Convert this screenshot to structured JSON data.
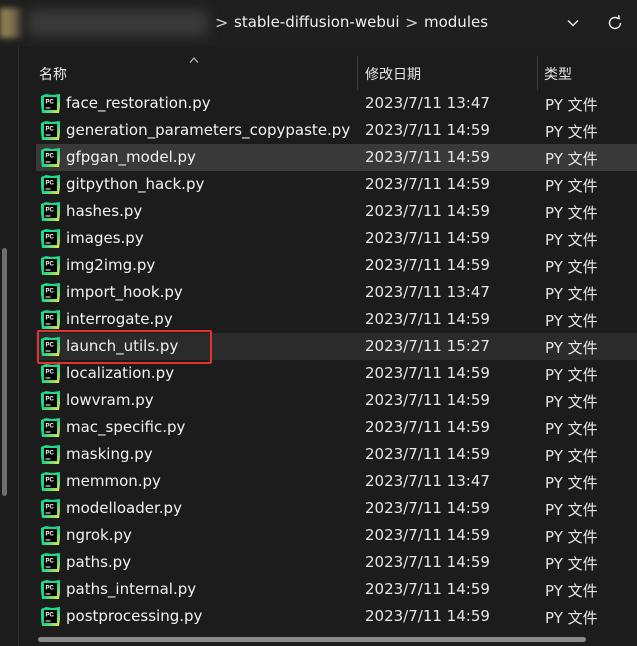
{
  "address_bar": {
    "crumbs": [
      "stable-diffusion-webui",
      "modules"
    ],
    "separator": ">",
    "dropdown_icon": "chevron-down-icon",
    "refresh_icon": "refresh-icon"
  },
  "columns": {
    "name": "名称",
    "modified": "修改日期",
    "type": "类型"
  },
  "files": [
    {
      "name": "face_restoration.py",
      "modified": "2023/7/11 13:47",
      "type": "PY 文件"
    },
    {
      "name": "generation_parameters_copypaste.py",
      "modified": "2023/7/11 14:59",
      "type": "PY 文件"
    },
    {
      "name": "gfpgan_model.py",
      "modified": "2023/7/11 14:59",
      "type": "PY 文件"
    },
    {
      "name": "gitpython_hack.py",
      "modified": "2023/7/11 14:59",
      "type": "PY 文件"
    },
    {
      "name": "hashes.py",
      "modified": "2023/7/11 14:59",
      "type": "PY 文件"
    },
    {
      "name": "images.py",
      "modified": "2023/7/11 14:59",
      "type": "PY 文件"
    },
    {
      "name": "img2img.py",
      "modified": "2023/7/11 14:59",
      "type": "PY 文件"
    },
    {
      "name": "import_hook.py",
      "modified": "2023/7/11 13:47",
      "type": "PY 文件"
    },
    {
      "name": "interrogate.py",
      "modified": "2023/7/11 14:59",
      "type": "PY 文件"
    },
    {
      "name": "launch_utils.py",
      "modified": "2023/7/11 15:27",
      "type": "PY 文件"
    },
    {
      "name": "localization.py",
      "modified": "2023/7/11 14:59",
      "type": "PY 文件"
    },
    {
      "name": "lowvram.py",
      "modified": "2023/7/11 14:59",
      "type": "PY 文件"
    },
    {
      "name": "mac_specific.py",
      "modified": "2023/7/11 14:59",
      "type": "PY 文件"
    },
    {
      "name": "masking.py",
      "modified": "2023/7/11 14:59",
      "type": "PY 文件"
    },
    {
      "name": "memmon.py",
      "modified": "2023/7/11 13:47",
      "type": "PY 文件"
    },
    {
      "name": "modelloader.py",
      "modified": "2023/7/11 14:59",
      "type": "PY 文件"
    },
    {
      "name": "ngrok.py",
      "modified": "2023/7/11 14:59",
      "type": "PY 文件"
    },
    {
      "name": "paths.py",
      "modified": "2023/7/11 14:59",
      "type": "PY 文件"
    },
    {
      "name": "paths_internal.py",
      "modified": "2023/7/11 14:59",
      "type": "PY 文件"
    },
    {
      "name": "postprocessing.py",
      "modified": "2023/7/11 14:59",
      "type": "PY 文件"
    }
  ],
  "selected_file": "gfpgan_model.py",
  "hovered_file": "launch_utils.py",
  "highlighted_file": "launch_utils.py",
  "colors": {
    "highlight_border": "#e0322e",
    "selected_row": "#393939",
    "background": "#1c1c1c"
  },
  "file_icon": "pycharm-file-icon"
}
